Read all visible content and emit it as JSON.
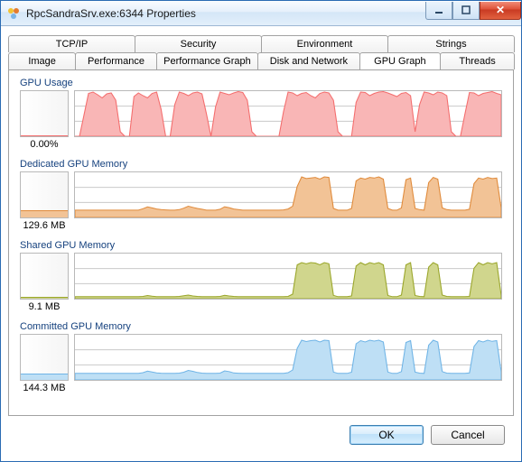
{
  "window": {
    "title": "RpcSandraSrv.exe:6344 Properties"
  },
  "tabs": {
    "row1": [
      "TCP/IP",
      "Security",
      "Environment",
      "Strings"
    ],
    "row2": [
      "Image",
      "Performance",
      "Performance Graph",
      "Disk and Network",
      "GPU Graph",
      "Threads"
    ],
    "active": "GPU Graph"
  },
  "sections": {
    "gpu_usage": {
      "title": "GPU Usage",
      "value": "0.00%",
      "color": "#f46d6d",
      "fill": "#f9b6b6",
      "mini_height_pct": 1
    },
    "dedicated": {
      "title": "Dedicated GPU Memory",
      "value": "129.6 MB",
      "color": "#e08a3a",
      "fill": "#f2c396",
      "mini_height_pct": 16
    },
    "shared": {
      "title": "Shared GPU Memory",
      "value": "9.1 MB",
      "color": "#9aa62a",
      "fill": "#d0d68d",
      "mini_height_pct": 5
    },
    "committed": {
      "title": "Committed GPU Memory",
      "value": "144.3 MB",
      "color": "#6fb4e6",
      "fill": "#bedff5",
      "mini_height_pct": 14
    }
  },
  "chart_data": [
    {
      "type": "area",
      "title": "GPU Usage",
      "ylabel": "%",
      "ylim": [
        0,
        100
      ],
      "xlim": [
        0,
        100
      ],
      "series": [
        {
          "name": "GPU",
          "values": [
            0,
            0,
            48,
            95,
            98,
            92,
            85,
            94,
            96,
            80,
            10,
            0,
            0,
            88,
            96,
            90,
            85,
            95,
            98,
            60,
            0,
            0,
            70,
            98,
            95,
            90,
            96,
            98,
            94,
            50,
            0,
            65,
            98,
            95,
            92,
            96,
            99,
            97,
            80,
            10,
            0,
            0,
            0,
            0,
            0,
            0,
            55,
            98,
            96,
            90,
            95,
            97,
            90,
            85,
            95,
            98,
            96,
            80,
            10,
            0,
            0,
            0,
            75,
            98,
            97,
            90,
            95,
            98,
            99,
            96,
            92,
            88,
            95,
            97,
            90,
            10,
            70,
            98,
            96,
            92,
            98,
            96,
            90,
            10,
            0,
            0,
            50,
            97,
            96,
            90,
            95,
            97,
            99,
            95,
            92
          ]
        }
      ]
    },
    {
      "type": "area",
      "title": "Dedicated GPU Memory",
      "ylabel": "MB",
      "ylim": [
        0,
        800
      ],
      "xlim": [
        0,
        100
      ],
      "series": [
        {
          "name": "Dedicated",
          "values": [
            130,
            130,
            130,
            130,
            130,
            130,
            130,
            130,
            130,
            130,
            130,
            130,
            130,
            130,
            130,
            155,
            188,
            170,
            150,
            140,
            135,
            130,
            130,
            140,
            165,
            200,
            180,
            160,
            145,
            130,
            130,
            130,
            145,
            190,
            175,
            150,
            140,
            130,
            130,
            130,
            130,
            130,
            130,
            130,
            130,
            130,
            135,
            150,
            200,
            550,
            720,
            690,
            700,
            710,
            680,
            720,
            710,
            160,
            130,
            130,
            130,
            160,
            650,
            700,
            680,
            710,
            700,
            720,
            680,
            160,
            130,
            130,
            170,
            670,
            700,
            160,
            140,
            130,
            620,
            710,
            680,
            170,
            140,
            130,
            130,
            130,
            130,
            145,
            600,
            700,
            680,
            710,
            690,
            700,
            170
          ]
        }
      ]
    },
    {
      "type": "area",
      "title": "Shared GPU Memory",
      "ylabel": "MB",
      "ylim": [
        0,
        200
      ],
      "xlim": [
        0,
        100
      ],
      "series": [
        {
          "name": "Shared",
          "values": [
            9,
            9,
            9,
            9,
            9,
            9,
            9,
            9,
            9,
            9,
            9,
            9,
            9,
            9,
            9,
            10,
            14,
            11,
            9,
            9,
            9,
            9,
            9,
            10,
            13,
            16,
            12,
            10,
            9,
            9,
            9,
            9,
            10,
            15,
            12,
            10,
            9,
            9,
            9,
            9,
            9,
            9,
            9,
            9,
            9,
            9,
            9,
            10,
            20,
            150,
            160,
            155,
            160,
            158,
            150,
            160,
            155,
            15,
            9,
            9,
            9,
            12,
            145,
            160,
            150,
            160,
            155,
            160,
            150,
            14,
            9,
            9,
            16,
            150,
            160,
            14,
            10,
            9,
            140,
            160,
            150,
            16,
            10,
            9,
            9,
            9,
            9,
            10,
            135,
            160,
            150,
            160,
            155,
            160,
            15
          ]
        }
      ]
    },
    {
      "type": "area",
      "title": "Committed GPU Memory",
      "ylabel": "MB",
      "ylim": [
        0,
        1000
      ],
      "xlim": [
        0,
        100
      ],
      "series": [
        {
          "name": "Committed",
          "values": [
            144,
            144,
            144,
            144,
            144,
            144,
            144,
            144,
            144,
            144,
            144,
            144,
            144,
            144,
            144,
            160,
            195,
            175,
            155,
            148,
            146,
            144,
            144,
            150,
            170,
            210,
            190,
            165,
            150,
            144,
            144,
            144,
            150,
            200,
            185,
            155,
            148,
            144,
            144,
            144,
            144,
            144,
            144,
            144,
            144,
            144,
            146,
            160,
            220,
            700,
            880,
            850,
            870,
            880,
            840,
            880,
            870,
            175,
            144,
            144,
            144,
            170,
            800,
            870,
            840,
            880,
            860,
            880,
            840,
            175,
            144,
            144,
            185,
            830,
            870,
            175,
            150,
            144,
            770,
            880,
            840,
            185,
            150,
            144,
            144,
            144,
            144,
            155,
            740,
            870,
            840,
            880,
            855,
            870,
            185
          ]
        }
      ]
    }
  ],
  "buttons": {
    "ok": "OK",
    "cancel": "Cancel"
  }
}
